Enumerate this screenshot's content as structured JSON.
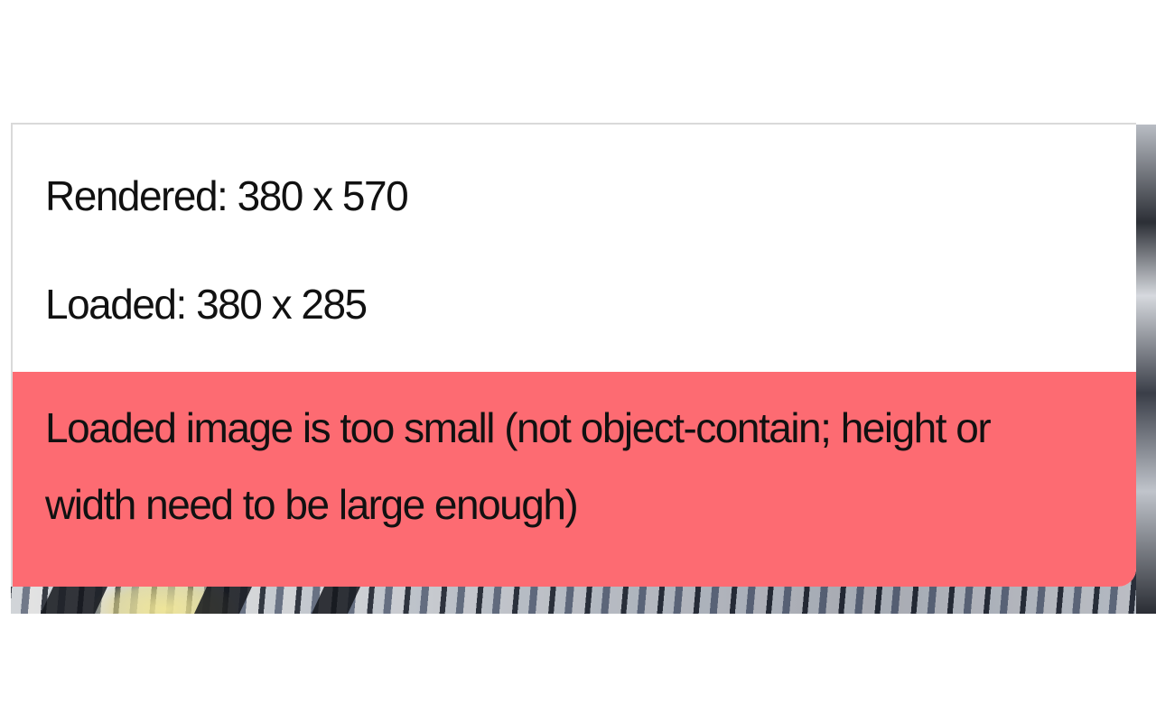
{
  "rendered": {
    "label": "Rendered:",
    "value": "380 x 570"
  },
  "loaded": {
    "label": "Loaded:",
    "value": "380 x 285"
  },
  "warning": {
    "message": "Loaded image is too small (not object-contain; height or width need to be large enough)",
    "background_color": "#fd6b72"
  }
}
